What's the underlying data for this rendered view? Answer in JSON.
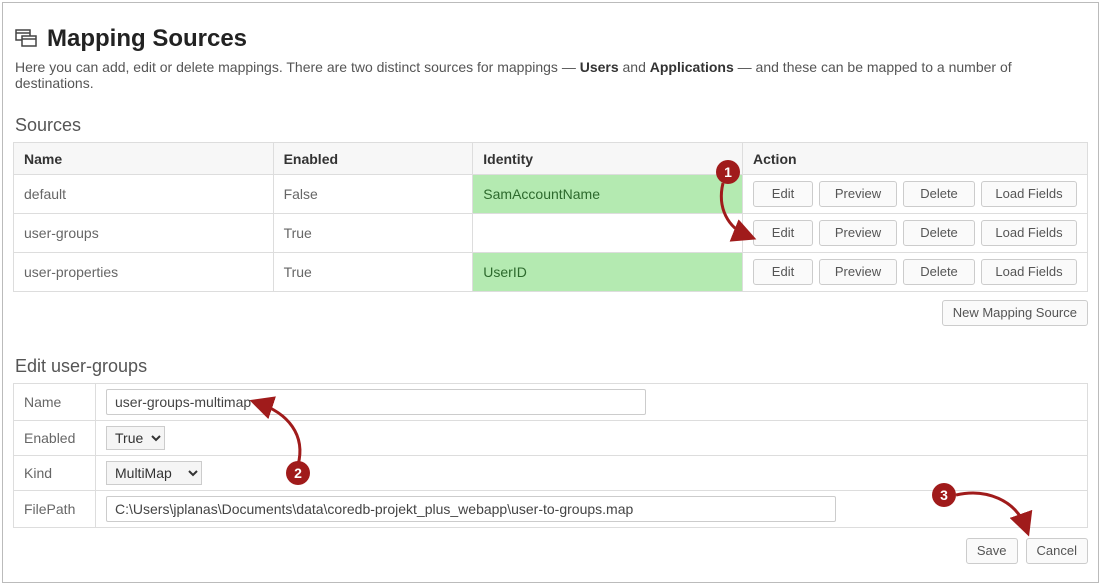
{
  "page": {
    "title": "Mapping Sources",
    "intro_prefix": "Here you can add, edit or delete mappings. There are two distinct sources for mappings — ",
    "intro_users": "Users",
    "intro_and": " and ",
    "intro_applications": "Applications",
    "intro_suffix": " — and these can be mapped to a number of destinations."
  },
  "sources": {
    "heading": "Sources",
    "columns": {
      "name": "Name",
      "enabled": "Enabled",
      "identity": "Identity",
      "action": "Action"
    },
    "rows": [
      {
        "name": "default",
        "enabled": "False",
        "identity": "SamAccountName",
        "identity_hl": true
      },
      {
        "name": "user-groups",
        "enabled": "True",
        "identity": "",
        "identity_hl": false
      },
      {
        "name": "user-properties",
        "enabled": "True",
        "identity": "UserID",
        "identity_hl": true
      }
    ],
    "actions": {
      "edit": "Edit",
      "preview": "Preview",
      "delete": "Delete",
      "load_fields": "Load Fields"
    },
    "new_button": "New Mapping Source"
  },
  "edit": {
    "heading": "Edit user-groups",
    "labels": {
      "name": "Name",
      "enabled": "Enabled",
      "kind": "Kind",
      "filepath": "FilePath"
    },
    "values": {
      "name": "user-groups-multimap",
      "enabled": "True",
      "kind": "MultiMap",
      "filepath": "C:\\Users\\jplanas\\Documents\\data\\coredb-projekt_plus_webapp\\user-to-groups.map"
    },
    "buttons": {
      "save": "Save",
      "cancel": "Cancel"
    }
  },
  "annotations": {
    "b1": "1",
    "b2": "2",
    "b3": "3"
  },
  "colors": {
    "accent": "#a01b1b",
    "highlight": "#b4eab1"
  }
}
